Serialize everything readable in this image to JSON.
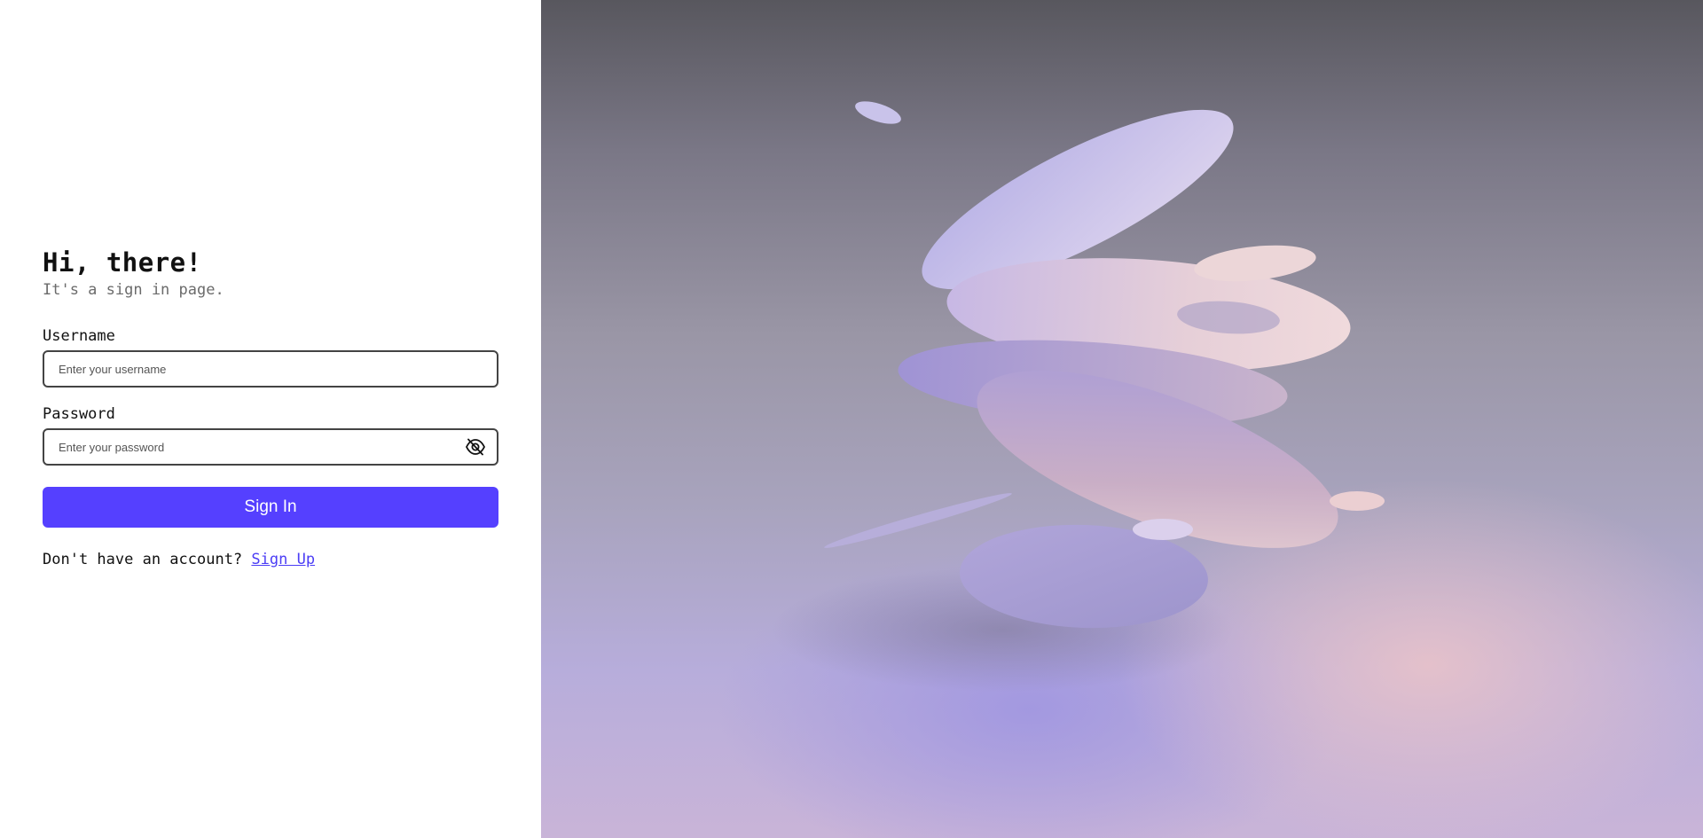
{
  "greeting": {
    "title": "Hi, there!",
    "subtitle": "It's a sign in page."
  },
  "form": {
    "username_label": "Username",
    "username_placeholder": "Enter your username",
    "username_value": "",
    "password_label": "Password",
    "password_placeholder": "Enter your password",
    "password_value": "",
    "password_toggle_icon": "eye-off-icon",
    "submit_label": "Sign In"
  },
  "signup": {
    "prompt": "Don't have an account?",
    "link_label": "Sign Up"
  },
  "colors": {
    "primary_button": "#5540ff",
    "link": "#4b3df5"
  }
}
